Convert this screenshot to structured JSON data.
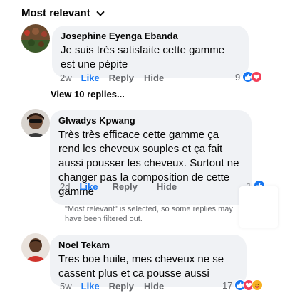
{
  "sort": {
    "label": "Most relevant"
  },
  "comments": [
    {
      "author": "Josephine Eyenga Ebanda",
      "text": "Je suis très satisfaite  cette gamme est une pépite",
      "time": "2w",
      "like": "Like",
      "reply": "Reply",
      "hide": "Hide",
      "reaction_count": "9",
      "reactions": [
        "like-icon",
        "love-icon"
      ]
    },
    {
      "author": "Glwadys Kpwang",
      "text": "Très très efficace cette gamme ça rend les cheveux souples et ça fait aussi pousser les cheveux. Surtout ne changer pas la composition de cette gamme",
      "time": "2d",
      "like": "Like",
      "reply": "Reply",
      "hide": "Hide",
      "reaction_count": "1",
      "reactions": [
        "like-icon"
      ]
    },
    {
      "author": "Noel Tekam",
      "text": "Tres boe huile, mes cheveux ne se cassent plus et ca pousse aussi",
      "time": "5w",
      "like": "Like",
      "reply": "Reply",
      "hide": "Hide",
      "reaction_count": "17",
      "reactions": [
        "like-icon",
        "love-icon",
        "care-icon"
      ]
    }
  ],
  "view_replies": "View 10 replies...",
  "notice": "\"Most relevant\" is selected, so some replies may have been filtered out.",
  "colors": {
    "like_blue": "#1877f2",
    "love_red": "#f33e58",
    "care_yellow": "#f7b125",
    "bubble_bg": "#f0f2f5",
    "secondary_text": "#65676b"
  }
}
